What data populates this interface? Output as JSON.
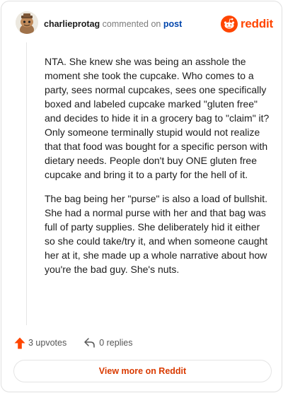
{
  "header": {
    "username": "charlieprotag",
    "action_text": "commented on",
    "post_link": "post",
    "brand": "reddit"
  },
  "comment": {
    "paragraphs": [
      "NTA. She knew she was being an asshole the moment she took the cupcake. Who comes to a party, sees normal cupcakes, sees one specifically boxed and labeled cupcake marked \"gluten free\" and decides to hide it in a grocery bag to \"claim\" it? Only someone terminally stupid would not realize that that food was bought for a specific person with dietary needs. People don't buy ONE gluten free cupcake and bring it to a party for the hell of it.",
      "The bag being her \"purse\" is also a load of bullshit. She had a normal purse with her and that bag was full of party supplies. She deliberately hid it either so she could take/try it, and when someone caught her at it, she made up a whole narrative about how you're the bad guy. She's nuts."
    ]
  },
  "actions": {
    "upvotes": "3 upvotes",
    "replies": "0 replies"
  },
  "footer": {
    "view_more": "View more on Reddit"
  },
  "colors": {
    "brand": "#ff4500",
    "link": "#0045ac",
    "view_more": "#d93a00"
  },
  "icons": {
    "avatar": "snoo-avatar",
    "logo": "reddit-logo-icon",
    "upvote": "upvote-arrow-icon",
    "reply": "reply-arrow-icon"
  }
}
